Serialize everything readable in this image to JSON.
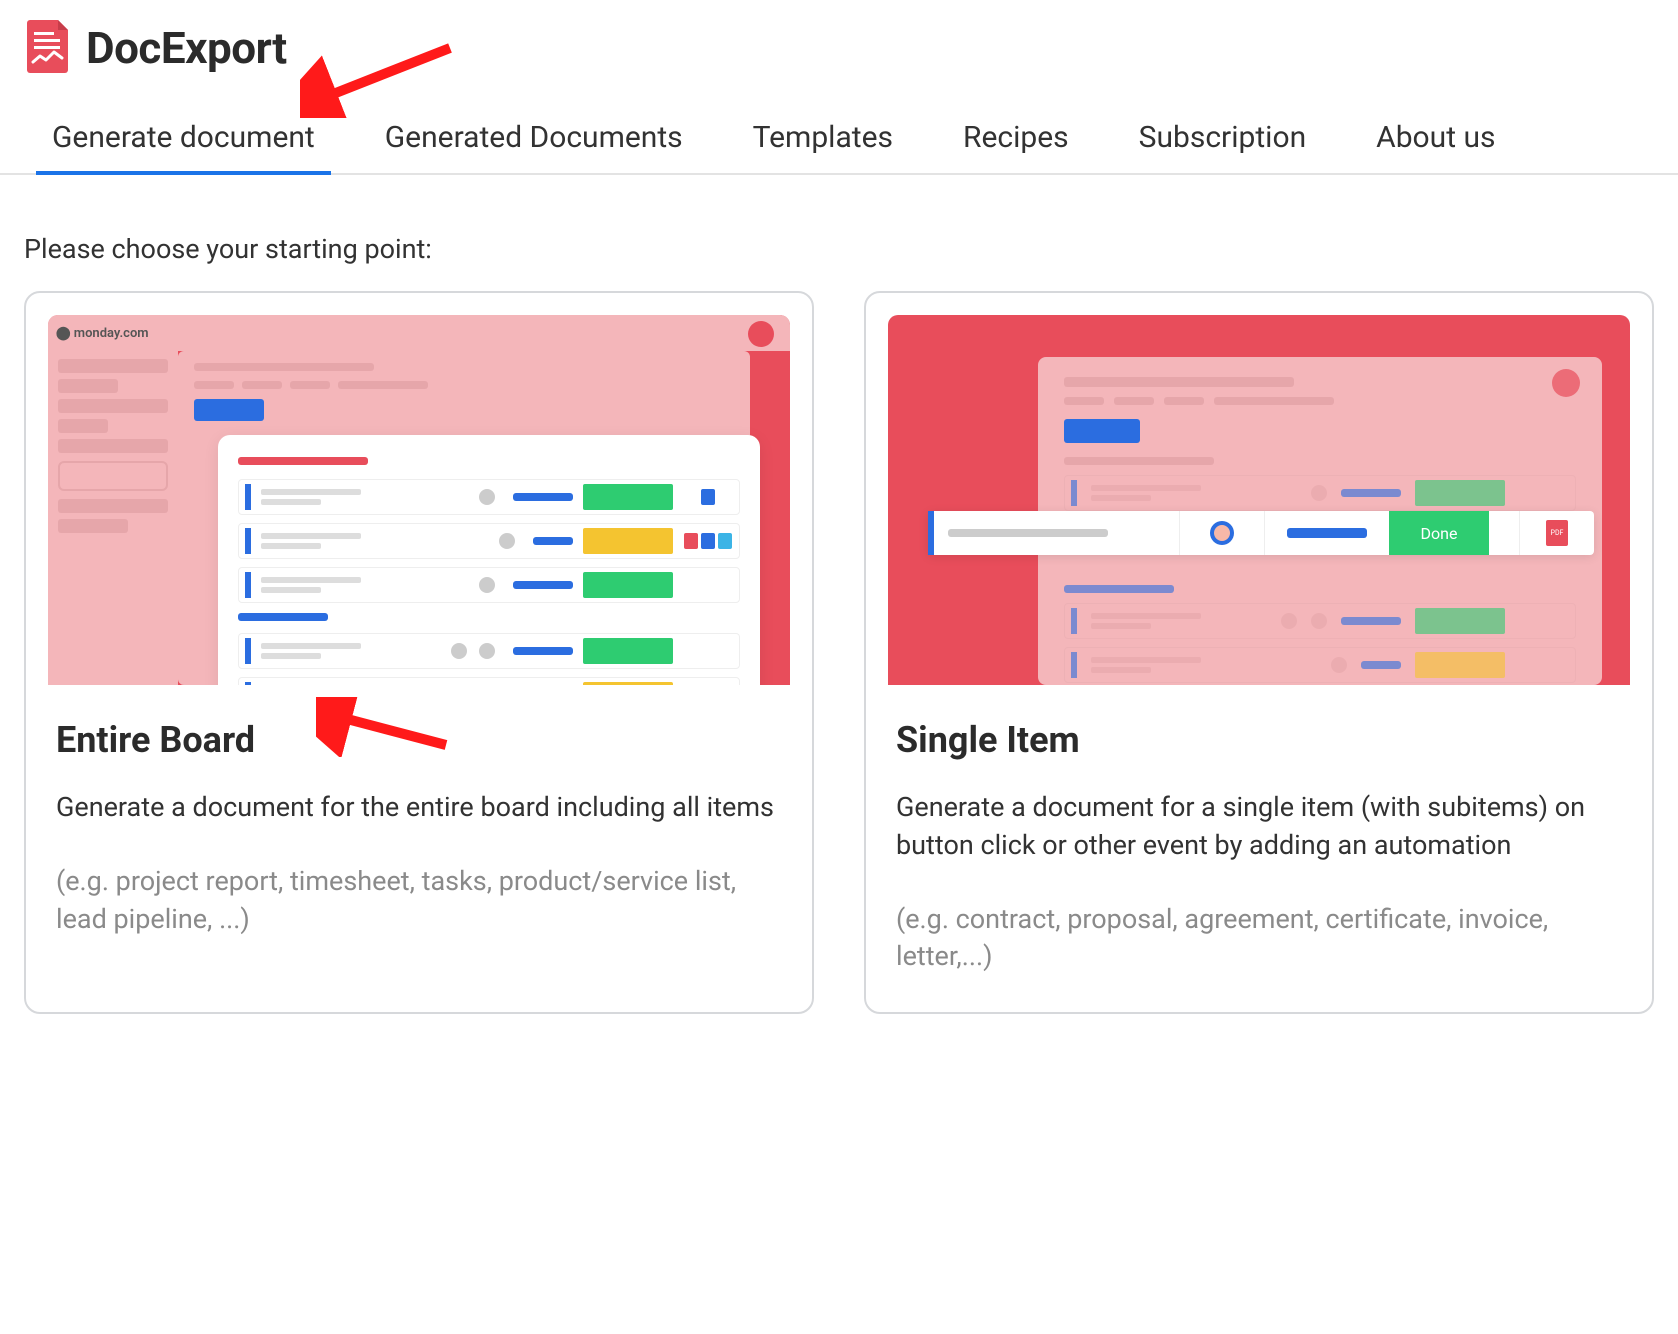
{
  "app": {
    "title": "DocExport"
  },
  "tabs": [
    "Generate document",
    "Generated Documents",
    "Templates",
    "Recipes",
    "Subscription",
    "About us"
  ],
  "active_tab_index": 0,
  "prompt": "Please choose your starting point:",
  "cards": {
    "entire_board": {
      "title": "Entire Board",
      "description": "Generate a document for the entire board including all items",
      "examples": "(e.g. project report, timesheet, tasks, product/service list, lead pipeline, ...)"
    },
    "single_item": {
      "title": "Single Item",
      "description": "Generate a document for a single item (with subitems) on button click or other event by adding an automation",
      "examples": "(e.g. contract, proposal, agreement, certificate, invoice, letter,...)",
      "done_label": "Done"
    }
  },
  "illustration_brand": "monday.com",
  "colors": {
    "accent_red": "#e84d5b",
    "accent_blue": "#1a73e8",
    "green": "#2ecc71",
    "yellow": "#f4c430"
  },
  "annotations": {
    "arrow_to_tab": true,
    "arrow_to_entire_board_title": true
  }
}
